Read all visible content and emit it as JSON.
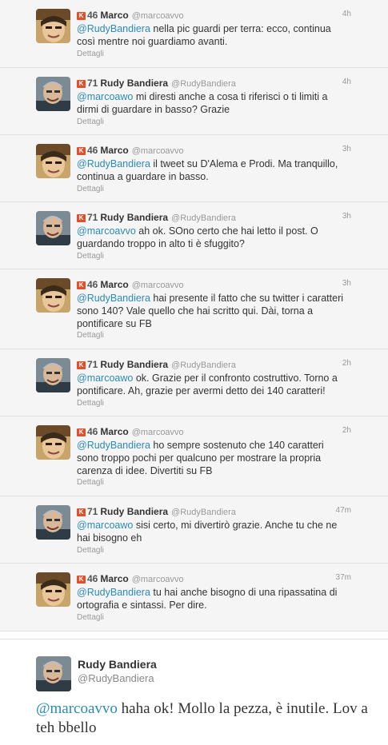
{
  "colors": {
    "mention": "#2a8ab8",
    "klout_badge": "#e0502a",
    "tweet_bg": "#f5f5f5"
  },
  "icons": {
    "klout": "klout-k-icon"
  },
  "tweets": [
    {
      "score": "46",
      "name": "Marco",
      "handle": "@marcoavvo",
      "time": "4h",
      "mention": "@RudyBandiera",
      "text": " nella pic guardi per terra: ecco, continua così mentre noi guardiamo avanti.",
      "details": "Dettagli",
      "author": "marco"
    },
    {
      "score": "71",
      "name": "Rudy Bandiera",
      "handle": "@RudyBandiera",
      "time": "4h",
      "mention": "@marcoawo",
      "text": " mi diresti anche a cosa ti riferisci o ti limiti a dirmi di guardare in basso? Grazie",
      "details": "Dettagli",
      "author": "rudy"
    },
    {
      "score": "46",
      "name": "Marco",
      "handle": "@marcoavvo",
      "time": "3h",
      "mention": "@RudyBandiera",
      "text": " il tweet su D'Alema e Prodi. Ma tranquillo, continua a guardare in basso.",
      "details": "Dettagli",
      "author": "marco"
    },
    {
      "score": "71",
      "name": "Rudy Bandiera",
      "handle": "@RudyBandiera",
      "time": "3h",
      "mention": "@marcoavvo",
      "text": " ah ok. SOno certo che hai letto il post. O guardando troppo in alto ti è sfuggito?",
      "details": "Dettagli",
      "author": "rudy"
    },
    {
      "score": "46",
      "name": "Marco",
      "handle": "@marcoavvo",
      "time": "3h",
      "mention": "@RudyBandiera",
      "text": " hai presente il fatto che su twitter i caratteri sono 140? Vale quello che hai scritto qui. Dài, torna a pontificare su FB",
      "details": "Dettagli",
      "author": "marco"
    },
    {
      "score": "71",
      "name": "Rudy Bandiera",
      "handle": "@RudyBandiera",
      "time": "2h",
      "mention": "@marcoawo",
      "text": " ok. Grazie per il confronto costruttivo. Torno a pontificare. Ah, grazie per avermi detto dei 140 caratteri!",
      "details": "Dettagli",
      "author": "rudy"
    },
    {
      "score": "46",
      "name": "Marco",
      "handle": "@marcoavvo",
      "time": "2h",
      "mention": "@RudyBandiera",
      "text": " ho sempre sostenuto che 140 caratteri sono troppo pochi per qualcuno per mostrare la propria carenza di idee. Divertiti su FB",
      "details": "Dettagli",
      "author": "marco"
    },
    {
      "score": "71",
      "name": "Rudy Bandiera",
      "handle": "@RudyBandiera",
      "time": "47m",
      "mention": "@marcoawo",
      "text": " sisi certo, mi divertirò grazie. Anche tu che ne hai bisogno eh",
      "details": "Dettagli",
      "author": "rudy"
    },
    {
      "score": "46",
      "name": "Marco",
      "handle": "@marcoavvo",
      "time": "37m",
      "mention": "@RudyBandiera",
      "text": " tu hai anche bisogno di una ripassatina di ortografia e sintassi. Per dire.",
      "details": "Dettagli",
      "author": "marco"
    }
  ],
  "expanded": {
    "name": "Rudy Bandiera",
    "handle": "@RudyBandiera",
    "mention": "@marcoavvo",
    "text": " haha ok! Mollo la pezza, è inutile. Lov a teh bbello",
    "author": "rudy"
  }
}
